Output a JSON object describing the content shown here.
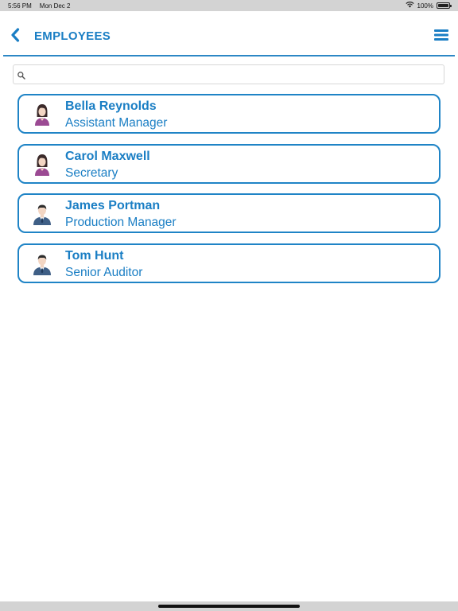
{
  "status_bar": {
    "time": "5:56 PM",
    "date": "Mon Dec 2",
    "battery": "100%"
  },
  "nav": {
    "title": "EMPLOYEES",
    "back_icon": "chevron-left-icon",
    "menu_icon": "hamburger-menu-icon"
  },
  "search": {
    "value": "",
    "placeholder": ""
  },
  "employees": [
    {
      "name": "Bella Reynolds",
      "role": "Assistant Manager",
      "avatar": "female-avatar-icon"
    },
    {
      "name": "Carol Maxwell",
      "role": "Secretary",
      "avatar": "female-avatar-icon"
    },
    {
      "name": "James Portman",
      "role": "Production Manager",
      "avatar": "male-avatar-icon"
    },
    {
      "name": "Tom Hunt",
      "role": "Senior Auditor",
      "avatar": "male-avatar-icon"
    }
  ],
  "colors": {
    "accent": "#1a7ec4",
    "border": "#1f84c6",
    "status_bar_bg": "#d3d3d3"
  }
}
